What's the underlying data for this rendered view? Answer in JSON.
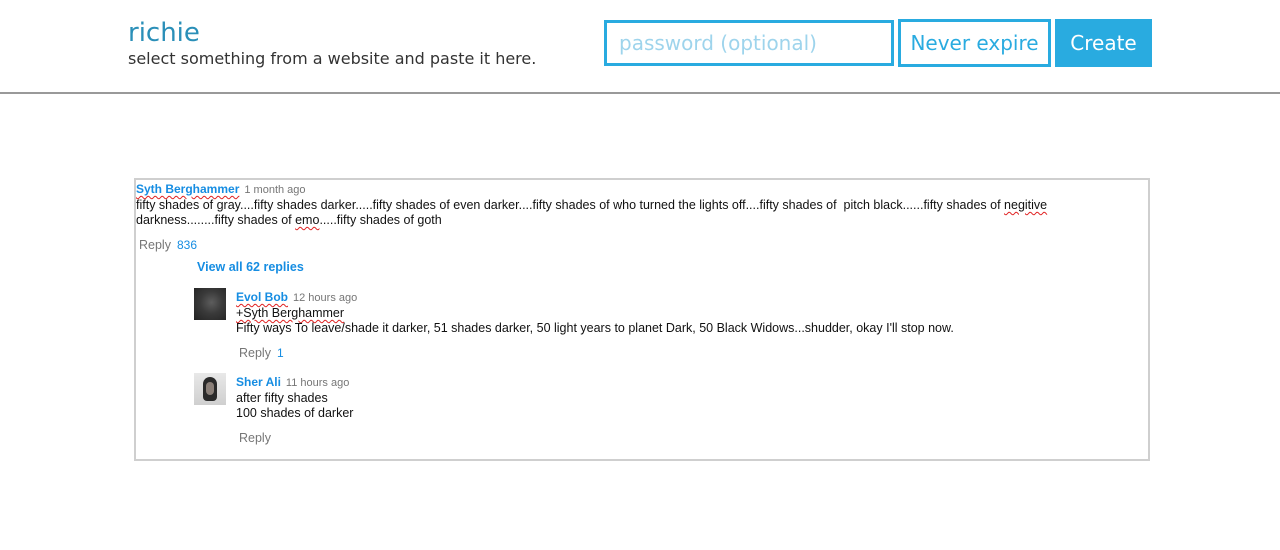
{
  "header": {
    "title": "richie",
    "subtitle": "select something from a website and paste it here.",
    "password_placeholder": "password (optional)",
    "expire_label": "Never expire",
    "create_label": "Create"
  },
  "thread": {
    "top_comment": {
      "author": "Syth Berghammer",
      "time": "1 month ago",
      "text": "fifty shades of gray....fifty shades darker.....fifty shades of even darker....fifty shades of who turned the lights off....fifty shades of  pitch black......fifty shades of negitive darkness........fifty shades of emo.....fifty shades of goth",
      "reply_label": "Reply",
      "likes": "836"
    },
    "view_replies_label": "View all 62 replies",
    "replies": [
      {
        "author": "Evol Bob",
        "time": "12 hours ago",
        "mention": "+Syth Berghammer",
        "text": "Fifty ways To leave/shade it darker, 51 shades darker, 50 light years to planet Dark, 50 Black Widows...shudder, okay I'll stop now.",
        "reply_label": "Reply",
        "likes": "1"
      },
      {
        "author": "Sher Ali",
        "time": "11 hours ago",
        "line1": "after fifty shades",
        "line2": "100 shades of darker",
        "reply_label": "Reply"
      }
    ]
  }
}
